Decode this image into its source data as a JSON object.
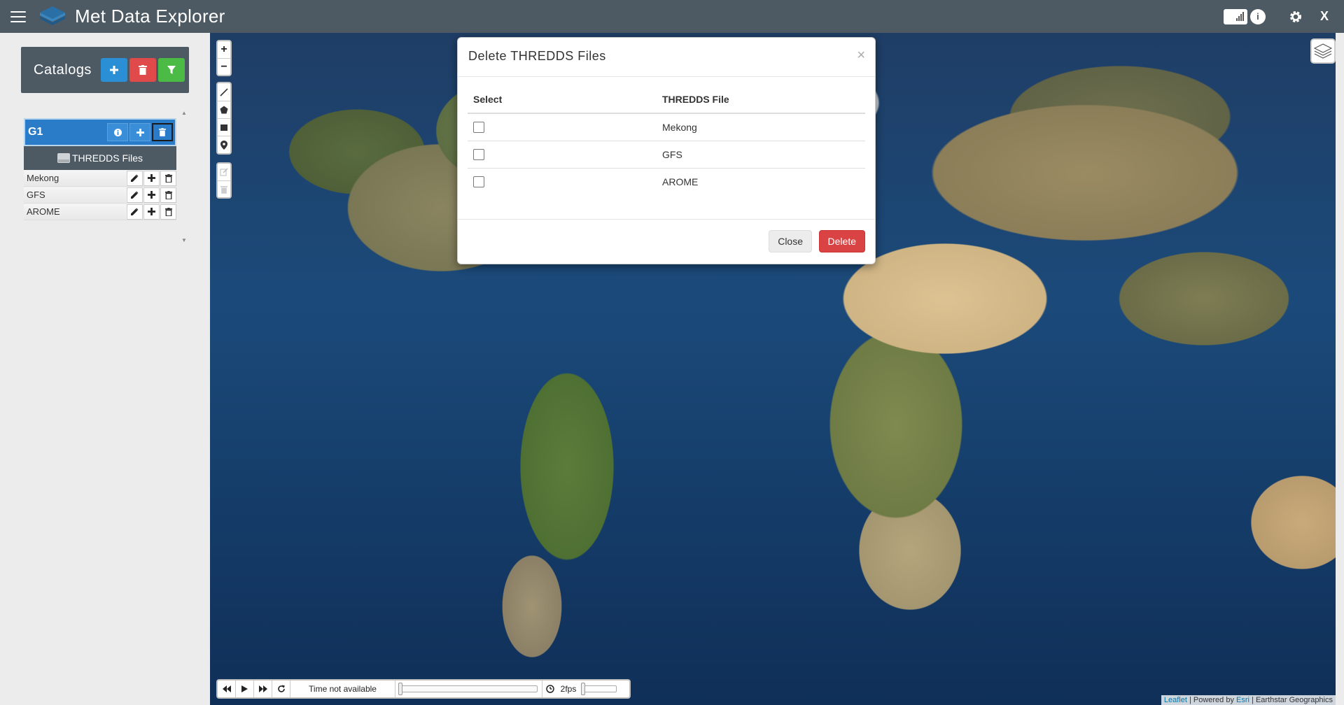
{
  "app": {
    "title": "Met Data Explorer",
    "close_label": "X"
  },
  "sidebar": {
    "catalogs_label": "Catalogs",
    "group": {
      "name": "G1",
      "section_label": "THREDDS Files",
      "files": [
        "Mekong",
        "GFS",
        "AROME"
      ]
    }
  },
  "map": {
    "time_text": "Time not available",
    "fps_text": "2fps",
    "attribution": {
      "leaflet": "Leaflet",
      "powered": " | Powered by ",
      "esri": "Esri",
      "rest": " | Earthstar Geographics"
    }
  },
  "modal": {
    "title": "Delete THREDDS Files",
    "close_symbol": "×",
    "columns": {
      "select": "Select",
      "file": "THREDDS File"
    },
    "rows": [
      "Mekong",
      "GFS",
      "AROME"
    ],
    "close_button": "Close",
    "delete_button": "Delete"
  },
  "colors": {
    "topbar": "#4d5a63",
    "primary": "#2b8fd6",
    "danger": "#d94343",
    "success": "#4cbb45"
  }
}
